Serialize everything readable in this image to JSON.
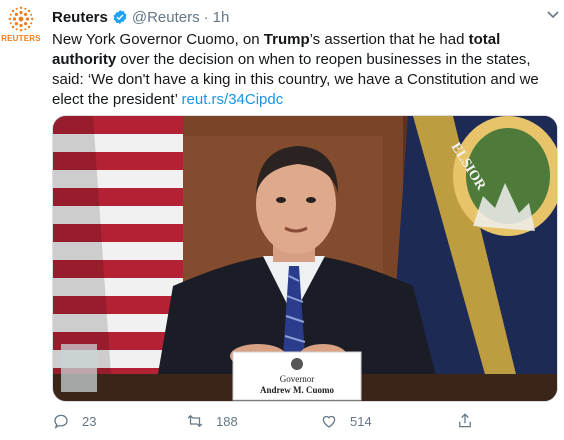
{
  "avatar": {
    "brand_word": "REUTERS",
    "icon": "reuters-logo-icon"
  },
  "tweet": {
    "display_name": "Reuters",
    "handle": "@Reuters",
    "separator": "·",
    "timestamp": "1h",
    "verified_icon": "verified-badge-icon",
    "text_1": "New York Governor Cuomo, on ",
    "text_bold_1": "Trump",
    "text_2": "’s assertion that he had ",
    "text_bold_2": "total authority",
    "text_3": " over the decision on when to reopen businesses in the states, said: ‘We don't have a king in this country, we have a Constitution and we elect the president’ ",
    "link": "reut.rs/34Cipdc"
  },
  "media": {
    "nameplate_line1": "Governor",
    "nameplate_line2": "Andrew M. Cuomo",
    "flag_text": "ELSIOR"
  },
  "actions": {
    "reply_count": "23",
    "retweet_count": "188",
    "like_count": "514"
  },
  "colors": {
    "link": "#1b95e0",
    "verified": "#1da1f2",
    "muted": "#657786",
    "brand_orange": "#ef7d19"
  }
}
